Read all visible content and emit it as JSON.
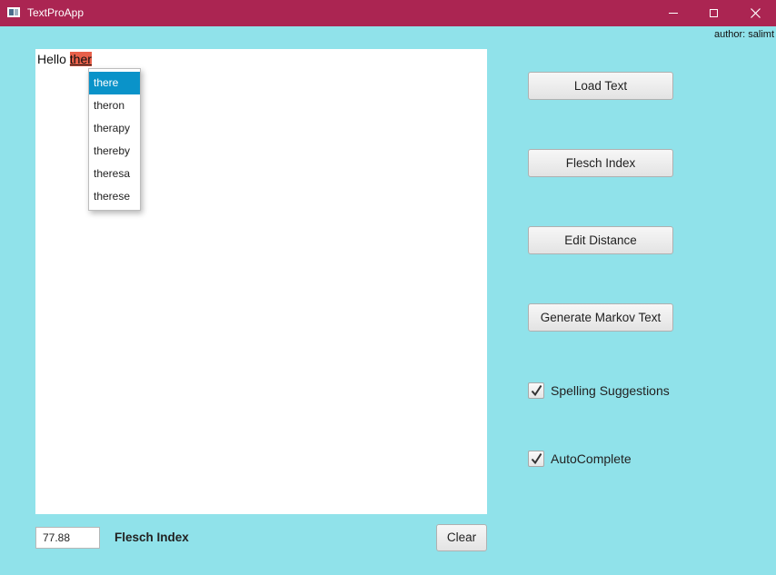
{
  "window": {
    "title": "TextProApp",
    "title_bar_color": "#ab2552",
    "background_color": "#90e2ea"
  },
  "author_label": "author: salimt",
  "editor": {
    "text_before": "Hello ",
    "misspelled_word": "ther",
    "misspelled_highlight_color": "#e8604a"
  },
  "suggestions": {
    "items": [
      "there",
      "theron",
      "therapy",
      "thereby",
      "theresa",
      "therese"
    ],
    "selected_index": 0,
    "selected_color": "#0a93c9"
  },
  "buttons": {
    "load_text": "Load Text",
    "flesch_index": "Flesch Index",
    "edit_distance": "Edit Distance",
    "generate_markov": "Generate Markov Text",
    "clear": "Clear"
  },
  "checkboxes": {
    "spelling_suggestions": {
      "label": "Spelling Suggestions",
      "checked": true
    },
    "autocomplete": {
      "label": "AutoComplete",
      "checked": true
    }
  },
  "footer": {
    "flesch_value": "77.88",
    "flesch_label": "Flesch Index"
  },
  "icons": {
    "app": "app-window-icon",
    "minimize": "minimize-icon",
    "maximize": "maximize-icon",
    "close": "close-icon",
    "check": "checkmark-icon"
  }
}
